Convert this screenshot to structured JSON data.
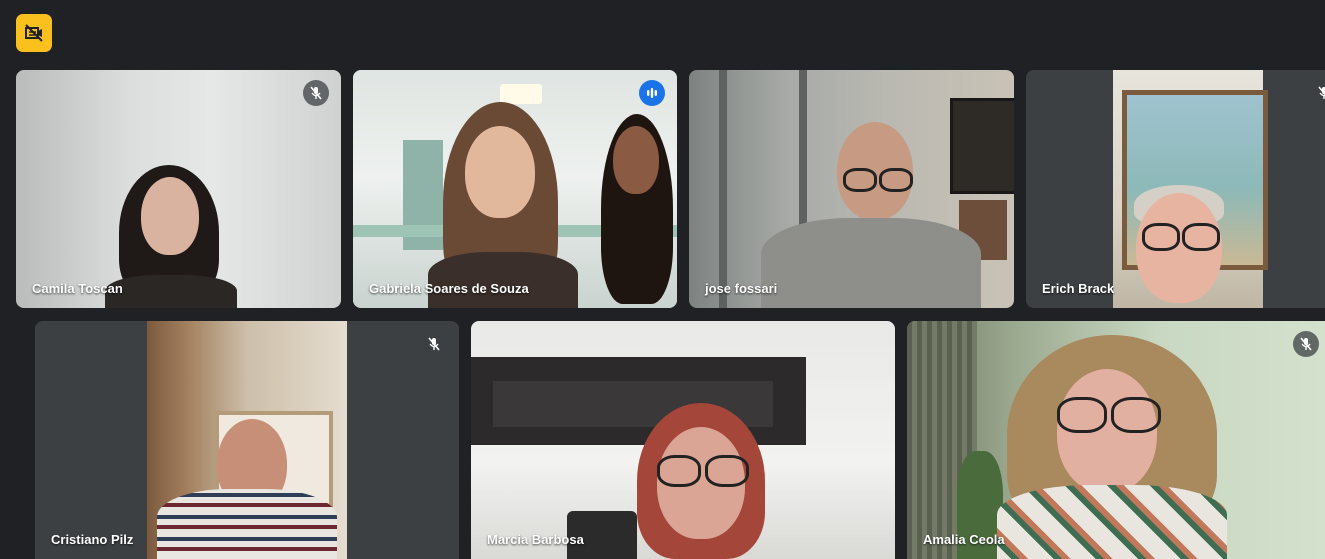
{
  "meeting": {
    "badge_icon": "camera-off-icon",
    "accent": "#f9c01e",
    "speaking_color": "#1a73e8"
  },
  "participants": [
    {
      "name": "Camila Toscan",
      "status": "muted"
    },
    {
      "name": "Gabriela Soares de Souza",
      "status": "speaking"
    },
    {
      "name": "jose fossari",
      "status": "unmuted"
    },
    {
      "name": "Erich Brack",
      "status": "muted"
    },
    {
      "name": "Cristiano Pilz",
      "status": "muted"
    },
    {
      "name": "Marcia Barbosa",
      "status": "unmuted"
    },
    {
      "name": "Amalia Ceola",
      "status": "muted"
    }
  ]
}
